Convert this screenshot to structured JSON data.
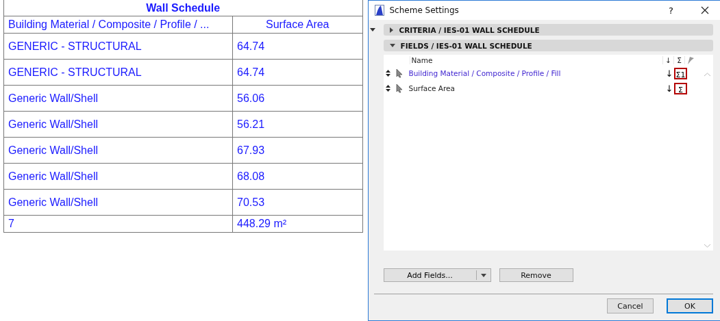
{
  "schedule": {
    "title": "Wall Schedule",
    "columns": [
      "Building Material / Composite / Profile / ...",
      "Surface Area"
    ],
    "rows": [
      [
        "GENERIC - STRUCTURAL",
        "64.74"
      ],
      [
        "GENERIC - STRUCTURAL",
        "64.74"
      ],
      [
        "Generic Wall/Shell",
        "56.06"
      ],
      [
        "Generic Wall/Shell",
        "56.21"
      ],
      [
        "Generic Wall/Shell",
        "67.93"
      ],
      [
        "Generic Wall/Shell",
        "68.08"
      ],
      [
        "Generic Wall/Shell",
        "70.53"
      ]
    ],
    "total": [
      "7",
      "448.29 m²"
    ]
  },
  "dialog": {
    "title": "Scheme Settings",
    "help": "?",
    "sections": [
      {
        "label": "CRITERIA / IES-01 WALL SCHEDULE",
        "expanded": false
      },
      {
        "label": "FIELDS / IES-01 WALL SCHEDULE",
        "expanded": true
      }
    ],
    "fields_header": {
      "name": "Name",
      "sort": "↓",
      "sum": "Σ"
    },
    "fields": [
      {
        "name": "Building Material / Composite / Profile / Fill",
        "selected": true,
        "sort": "↓",
        "sum": "Σ1"
      },
      {
        "name": "Surface Area",
        "selected": false,
        "sort": "↓",
        "sum": "Σ"
      }
    ],
    "add_button": "Add Fields...",
    "remove_button": "Remove",
    "cancel_button": "Cancel",
    "ok_button": "OK"
  }
}
